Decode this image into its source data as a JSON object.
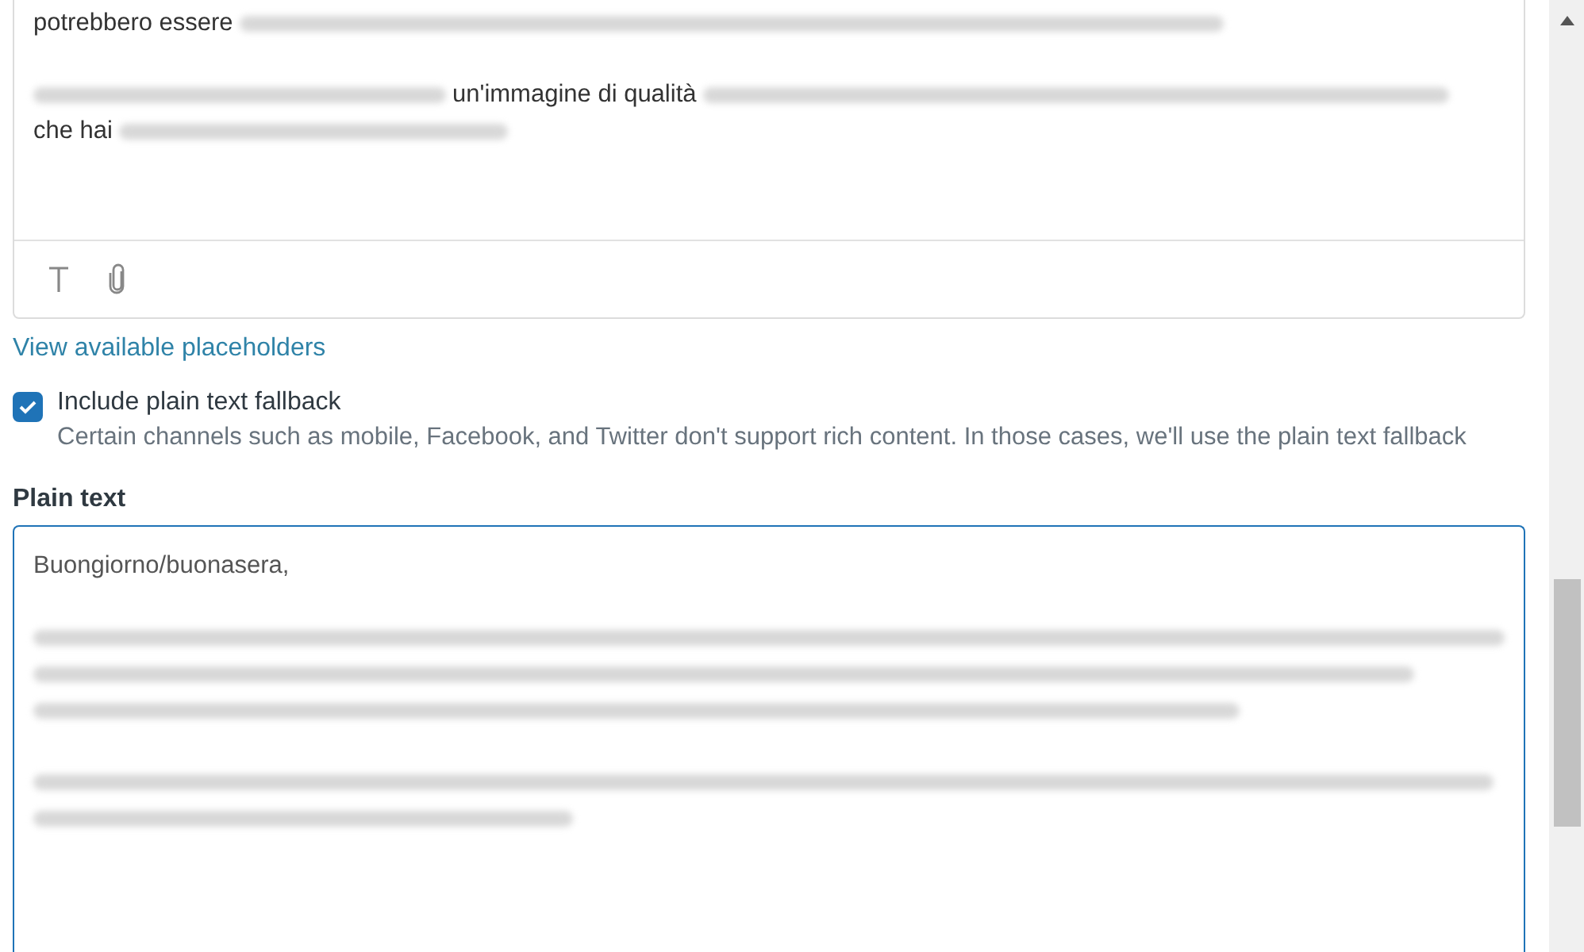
{
  "editor": {
    "lines": [
      [
        {
          "kind": "text",
          "text": "potrebbero essere"
        },
        {
          "kind": "blur"
        }
      ],
      [
        {
          "kind": "gap"
        }
      ],
      [
        {
          "kind": "blur"
        },
        {
          "kind": "text",
          "text": "un'immagine di qualità"
        },
        {
          "kind": "blur"
        }
      ],
      [
        {
          "kind": "text",
          "text": "che hai"
        },
        {
          "kind": "blur"
        }
      ]
    ]
  },
  "link": "View available placeholders",
  "fallback": {
    "label": "Include plain text fallback",
    "checked": true,
    "description": "Certain channels such as mobile, Facebook, and Twitter don't support rich content. In those cases, we'll use the plain text fallback"
  },
  "plain_text": {
    "label": "Plain text",
    "lines": [
      [
        {
          "kind": "text",
          "text": "Buongiorno/buonasera,"
        }
      ],
      [
        {
          "kind": "gap"
        }
      ],
      [
        {
          "kind": "blur"
        }
      ],
      [
        {
          "kind": "blur"
        }
      ],
      [
        {
          "kind": "blur"
        }
      ],
      [
        {
          "kind": "gap"
        }
      ],
      [
        {
          "kind": "blur"
        }
      ],
      [
        {
          "kind": "blur"
        }
      ]
    ]
  }
}
